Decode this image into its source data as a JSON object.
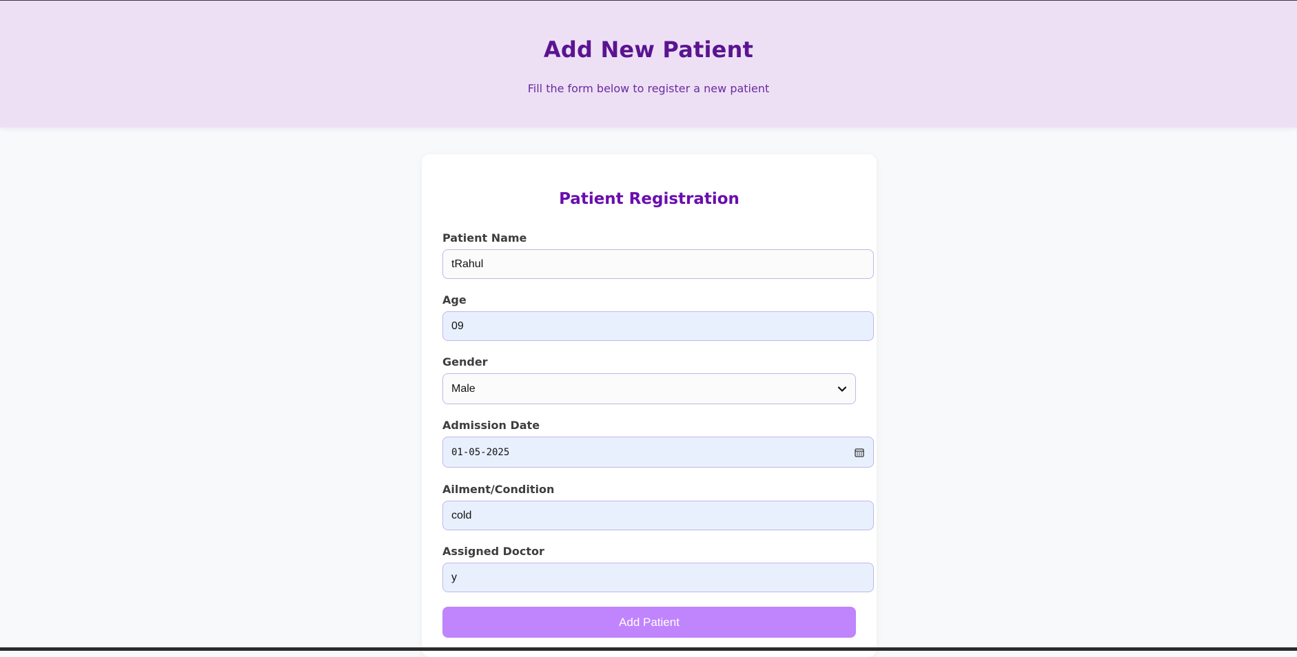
{
  "header": {
    "title": "Add New Patient",
    "subtitle": "Fill the form below to register a new patient"
  },
  "form": {
    "title": "Patient Registration",
    "fields": {
      "name": {
        "label": "Patient Name",
        "value": "tRahul"
      },
      "age": {
        "label": "Age",
        "value": "09"
      },
      "gender": {
        "label": "Gender",
        "value": "Male"
      },
      "admission_date": {
        "label": "Admission Date",
        "value": "01-05-2025"
      },
      "ailment": {
        "label": "Ailment/Condition",
        "value": "cold"
      },
      "doctor": {
        "label": "Assigned Doctor",
        "value": "y"
      }
    },
    "submit_label": "Add Patient"
  },
  "colors": {
    "header_bg": "#ede0f5",
    "title": "#5a1490",
    "accent": "#c084fc",
    "autofill_bg": "#e8f0fe"
  },
  "icons": [
    "chevron-down-icon",
    "calendar-icon"
  ]
}
